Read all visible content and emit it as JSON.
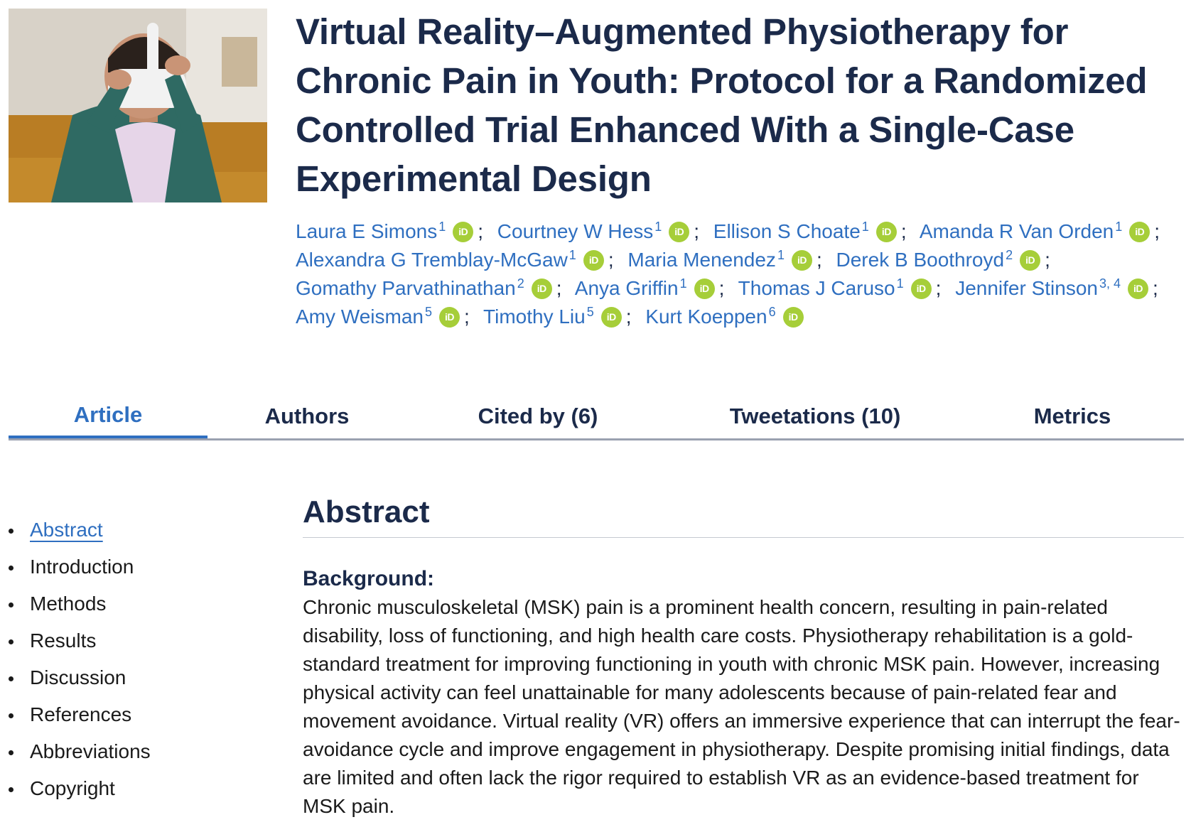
{
  "title": "Virtual Reality–Augmented Physiotherapy for Chronic Pain in Youth: Protocol for a Randomized Controlled Trial Enhanced With a Single-Case Experimental Design",
  "orcid_label": "iD",
  "orcid_color": "#a6ce39",
  "link_color": "#2f6fc0",
  "authors": [
    {
      "name": "Laura E Simons",
      "aff": "1"
    },
    {
      "name": "Courtney W Hess",
      "aff": "1"
    },
    {
      "name": "Ellison S Choate",
      "aff": "1"
    },
    {
      "name": "Amanda R Van Orden",
      "aff": "1"
    },
    {
      "name": "Alexandra G Tremblay-McGaw",
      "aff": "1"
    },
    {
      "name": "Maria Menendez",
      "aff": "1"
    },
    {
      "name": "Derek B Boothroyd",
      "aff": "2"
    },
    {
      "name": "Gomathy Parvathinathan",
      "aff": "2"
    },
    {
      "name": "Anya Griffin",
      "aff": "1"
    },
    {
      "name": "Thomas J Caruso",
      "aff": "1"
    },
    {
      "name": "Jennifer Stinson",
      "aff": "3, 4"
    },
    {
      "name": "Amy Weisman",
      "aff": "5"
    },
    {
      "name": "Timothy Liu",
      "aff": "5"
    },
    {
      "name": "Kurt Koeppen",
      "aff": "6"
    }
  ],
  "tabs": [
    {
      "label": "Article",
      "active": true
    },
    {
      "label": "Authors",
      "active": false
    },
    {
      "label": "Cited by (6)",
      "active": false
    },
    {
      "label": "Tweetations (10)",
      "active": false
    },
    {
      "label": "Metrics",
      "active": false
    }
  ],
  "toc": [
    {
      "label": "Abstract",
      "active": true
    },
    {
      "label": "Introduction",
      "active": false
    },
    {
      "label": "Methods",
      "active": false
    },
    {
      "label": "Results",
      "active": false
    },
    {
      "label": "Discussion",
      "active": false
    },
    {
      "label": "References",
      "active": false
    },
    {
      "label": "Abbreviations",
      "active": false
    },
    {
      "label": "Copyright",
      "active": false
    }
  ],
  "abstract": {
    "heading": "Abstract",
    "background_heading": "Background:",
    "background_text": "Chronic musculoskeletal (MSK) pain is a prominent health concern, resulting in pain-related disability, loss of functioning, and high health care costs. Physiotherapy rehabilitation is a gold-standard treatment for improving functioning in youth with chronic MSK pain. However, increasing physical activity can feel unattainable for many adolescents because of pain-related fear and movement avoidance. Virtual reality (VR) offers an immersive experience that can interrupt the fear-avoidance cycle and improve engagement in physiotherapy. Despite promising initial findings, data are limited and often lack the rigor required to establish VR as an evidence-based treatment for MSK pain."
  }
}
